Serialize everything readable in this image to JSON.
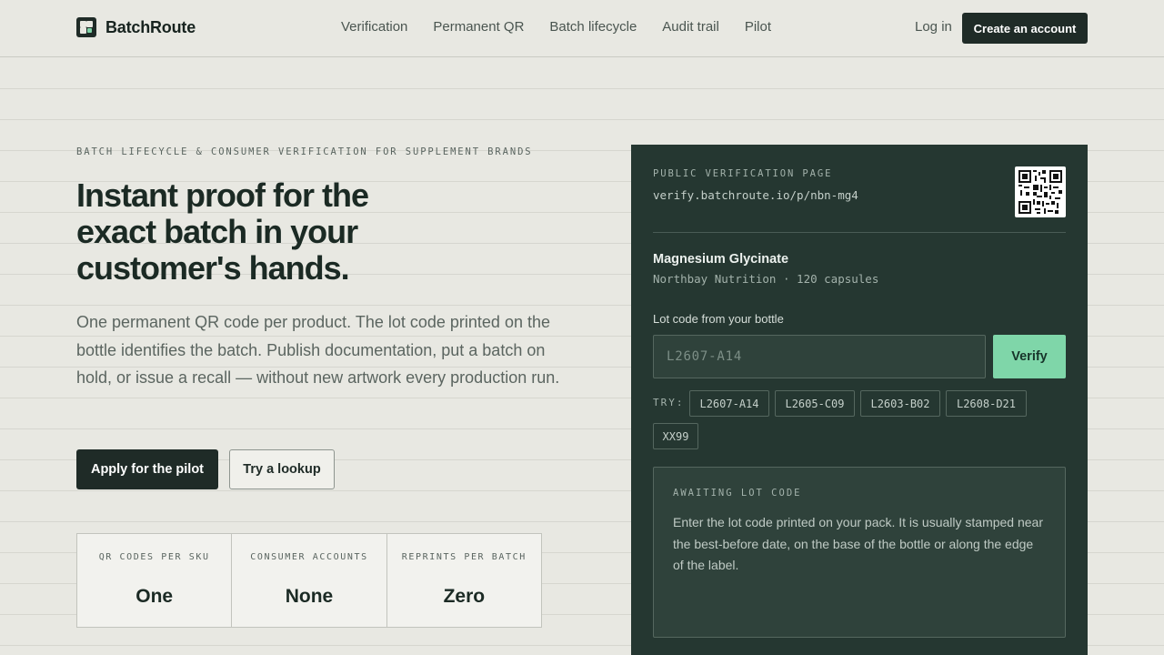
{
  "header": {
    "brand": "BatchRoute",
    "nav": [
      "Verification",
      "Permanent QR",
      "Batch lifecycle",
      "Audit trail",
      "Pilot"
    ],
    "login": "Log in",
    "create_account": "Create an account"
  },
  "hero": {
    "eyebrow": "BATCH LIFECYCLE & CONSUMER VERIFICATION FOR SUPPLEMENT BRANDS",
    "headline": [
      "Instant proof for the",
      "exact batch in your",
      "customer's hands."
    ],
    "lede": "One permanent QR code per product. The lot code printed on the bottle identifies the batch. Publish documentation, put a batch on hold, or issue a recall — without new artwork every production run.",
    "primary_cta": "Apply for the pilot",
    "secondary_cta": "Try a lookup",
    "stats": [
      {
        "label": "QR CODES PER SKU",
        "value": "One"
      },
      {
        "label": "CONSUMER ACCOUNTS",
        "value": "None"
      },
      {
        "label": "REPRINTS PER BATCH",
        "value": "Zero"
      }
    ]
  },
  "card": {
    "eyebrow": "PUBLIC VERIFICATION PAGE",
    "url": "verify.batchroute.io/p/nbn-mg4",
    "qr_icon": "qr-code-icon",
    "product_name": "Magnesium Glycinate",
    "product_sub": "Northbay Nutrition · 120 capsules",
    "lot_label": "Lot code from your bottle",
    "lot_input_value": "",
    "lot_placeholder": "L2607-A14",
    "verify": "Verify",
    "try_label": "TRY:",
    "chips": [
      "L2607-A14",
      "L2605-C09",
      "L2603-B02",
      "L2608-D21",
      "XX99"
    ],
    "status_title": "AWAITING LOT CODE",
    "status_text": "Enter the lot code printed on your pack. It is usually stamped near the best-before date, on the base of the bottle or along the edge of the label."
  },
  "colors": {
    "background": "#e8e8e2",
    "dark": "#1f2b27",
    "card": "#253731",
    "accent": "#7fd6a9"
  }
}
